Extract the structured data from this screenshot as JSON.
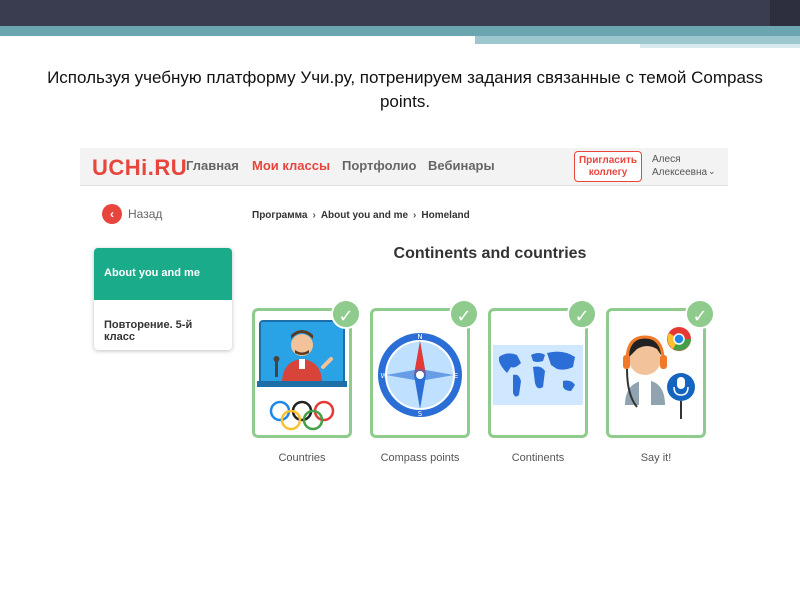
{
  "slide": {
    "text": "Используя учебную платформу Учи.ру, потренируем задания связанные с темой Compass points."
  },
  "platform": {
    "logo": "UCHi.RU",
    "nav": [
      "Главная",
      "Мои классы",
      "Портфолио",
      "Вебинары"
    ],
    "invite_button": "Пригласить коллегу",
    "user": {
      "name": "Алеся Алексеевна",
      "chevron": "⌄"
    },
    "back": {
      "icon": "‹",
      "label": "Назад"
    },
    "sidebar": [
      {
        "label": "About you and me"
      },
      {
        "label": "Повторение. 5-й класс"
      }
    ],
    "breadcrumb": [
      "Программа",
      "About you and me",
      "Homeland"
    ],
    "breadcrumb_sep": "›",
    "section_title": "Continents and countries",
    "tasks": [
      {
        "label": "Countries",
        "icon": "teacher-olympic-icon",
        "check": "✓"
      },
      {
        "label": "Compass points",
        "icon": "compass-icon",
        "check": "✓"
      },
      {
        "label": "Continents",
        "icon": "world-map-icon",
        "check": "✓"
      },
      {
        "label": "Say it!",
        "icon": "headphones-mic-icon",
        "check": "✓"
      }
    ],
    "colors": {
      "accent": "#e8453c",
      "active": "#1aab8b",
      "done": "#8ecb8d"
    }
  }
}
